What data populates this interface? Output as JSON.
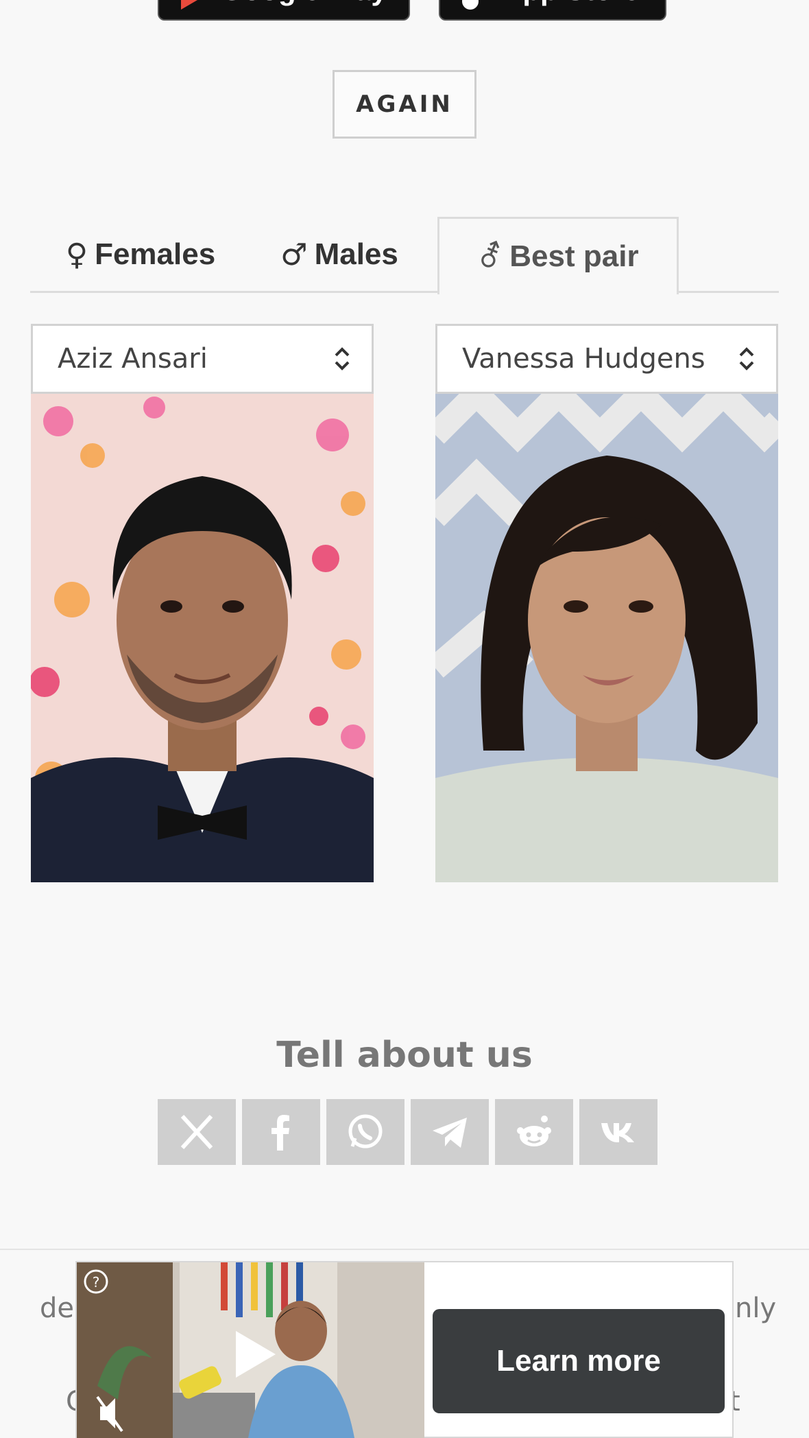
{
  "store_buttons": {
    "google_play": "Google Play",
    "app_store": "App Store"
  },
  "again_label": "AGAIN",
  "tabs": [
    {
      "symbol": "♀",
      "label": "Females"
    },
    {
      "symbol": "♂",
      "label": "Males"
    },
    {
      "symbol": "⚦",
      "label": "Best pair"
    }
  ],
  "pair": {
    "male_name": "Aziz Ansari",
    "female_name": "Vanessa Hudgens"
  },
  "share": {
    "title": "Tell about us",
    "networks": [
      "x-icon",
      "facebook-icon",
      "whatsapp-icon",
      "telegram-icon",
      "reddit-icon",
      "vk-icon"
    ]
  },
  "footer_fragments": {
    "line1_left": "de",
    "line1_right": "nly",
    "line2_left": "C",
    "line2_right": "t"
  },
  "ad": {
    "cta": "Learn more"
  },
  "colors": {
    "background": "#f8f8f8",
    "share_button": "#cfcfcf",
    "ad_button": "#3a3d3f"
  }
}
